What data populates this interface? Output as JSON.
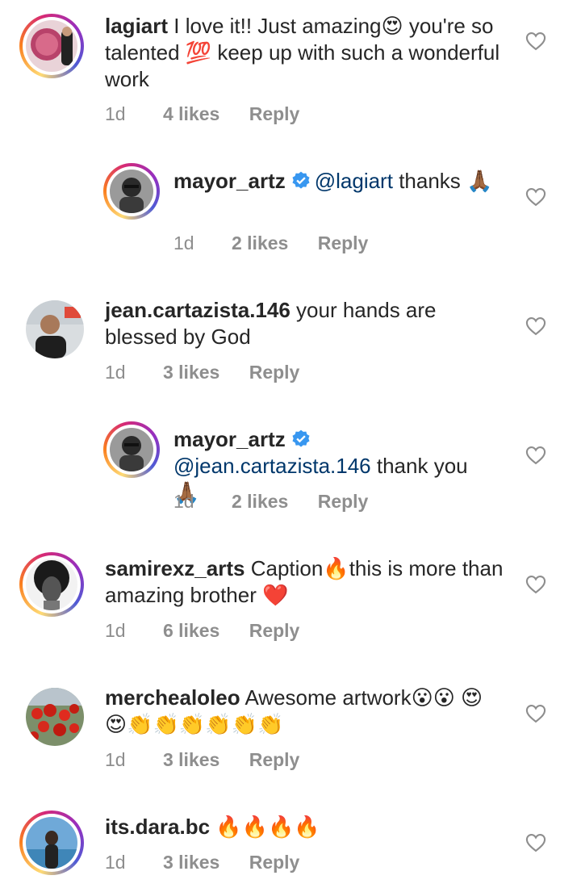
{
  "comments": [
    {
      "username": "lagiart",
      "text": "I love it!! Just amazing😍 you're so talented 💯 keep up with such a wonderful work",
      "time": "1d",
      "likes": "4 likes",
      "reply": "Reply"
    },
    {
      "username": "mayor_artz",
      "mention": "@lagiart",
      "text": "thanks 🙏🏾",
      "time": "1d",
      "likes": "2 likes",
      "reply": "Reply"
    },
    {
      "username": "jean.cartazista.146",
      "text": "your hands are blessed by God",
      "time": "1d",
      "likes": "3 likes",
      "reply": "Reply"
    },
    {
      "username": "mayor_artz",
      "mention": "@jean.cartazista.146",
      "text": "thank you 🙏🏾",
      "time": "1d",
      "likes": "2 likes",
      "reply": "Reply"
    },
    {
      "username": "samirexz_arts",
      "text": "Caption🔥this is more than amazing brother ❤️",
      "time": "1d",
      "likes": "6 likes",
      "reply": "Reply"
    },
    {
      "username": "merchealoleo",
      "text": "Awesome artwork😮😮 😍😍👏👏👏👏👏👏",
      "time": "1d",
      "likes": "3 likes",
      "reply": "Reply"
    },
    {
      "username": "its.dara.bc",
      "text": "🔥🔥🔥🔥",
      "time": "1d",
      "likes": "3 likes",
      "reply": "Reply"
    }
  ],
  "icons": {
    "like": "heart-outline-icon",
    "verified": "verified-badge-icon"
  },
  "colors": {
    "mention": "#00376b",
    "meta": "#8e8e8e",
    "verified": "#3897f0"
  }
}
